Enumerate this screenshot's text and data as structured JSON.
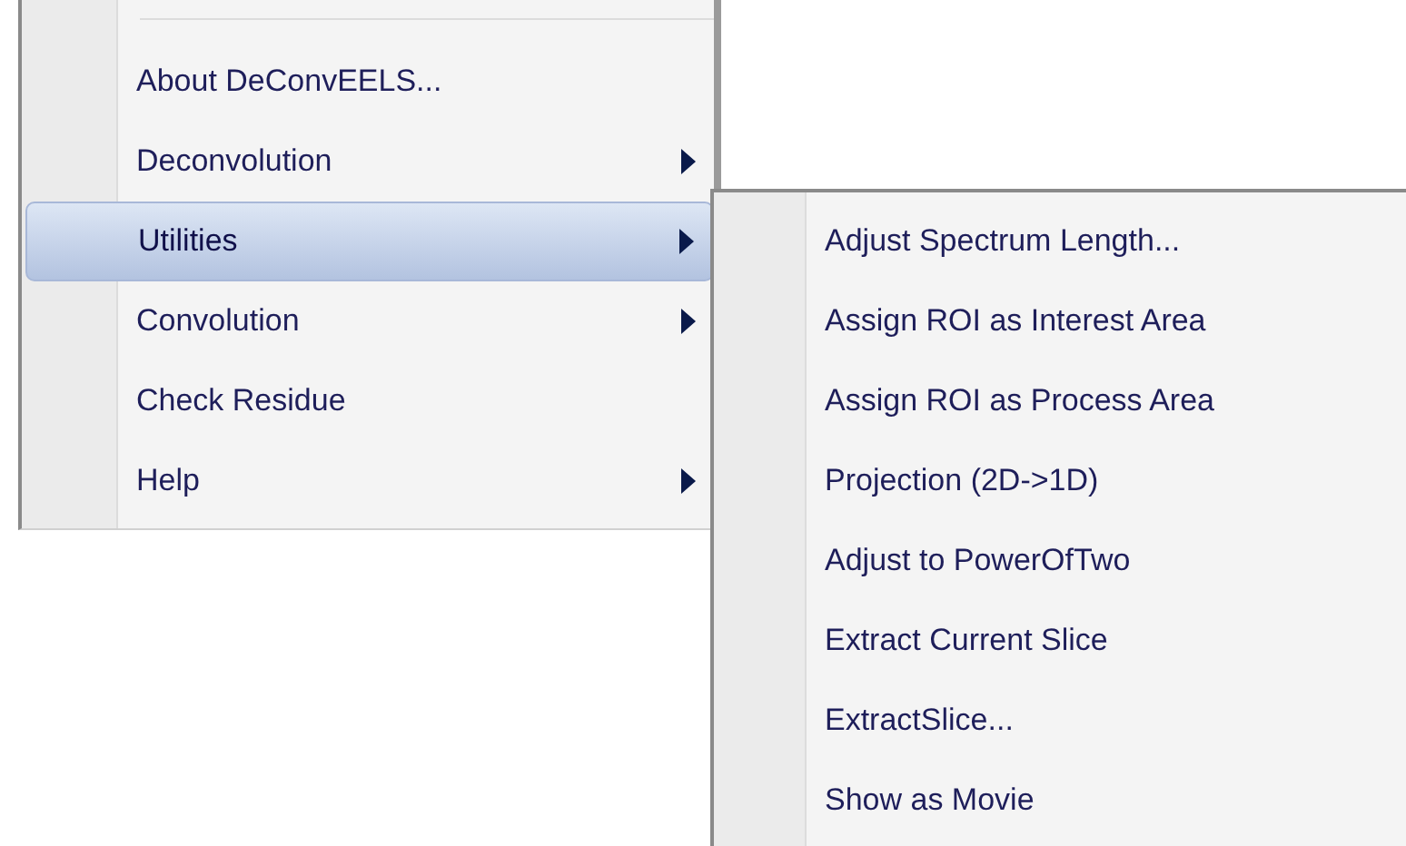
{
  "menu": {
    "items": [
      {
        "label": "About DeConvEELS...",
        "kind": "command",
        "selected": false
      },
      {
        "label": "Deconvolution",
        "kind": "submenu",
        "selected": false
      },
      {
        "label": "Utilities",
        "kind": "submenu",
        "selected": true,
        "children": [
          {
            "label": "Adjust Spectrum Length..."
          },
          {
            "label": "Assign ROI as Interest Area"
          },
          {
            "label": "Assign ROI as Process Area"
          },
          {
            "label": "Projection (2D->1D)"
          },
          {
            "label": "Adjust to PowerOfTwo"
          },
          {
            "label": "Extract Current Slice"
          },
          {
            "label": "ExtractSlice..."
          },
          {
            "label": "Show as Movie"
          }
        ]
      },
      {
        "label": "Convolution",
        "kind": "submenu",
        "selected": false
      },
      {
        "label": "Check Residue",
        "kind": "command",
        "selected": false
      },
      {
        "label": "Help",
        "kind": "submenu",
        "selected": false
      }
    ]
  }
}
